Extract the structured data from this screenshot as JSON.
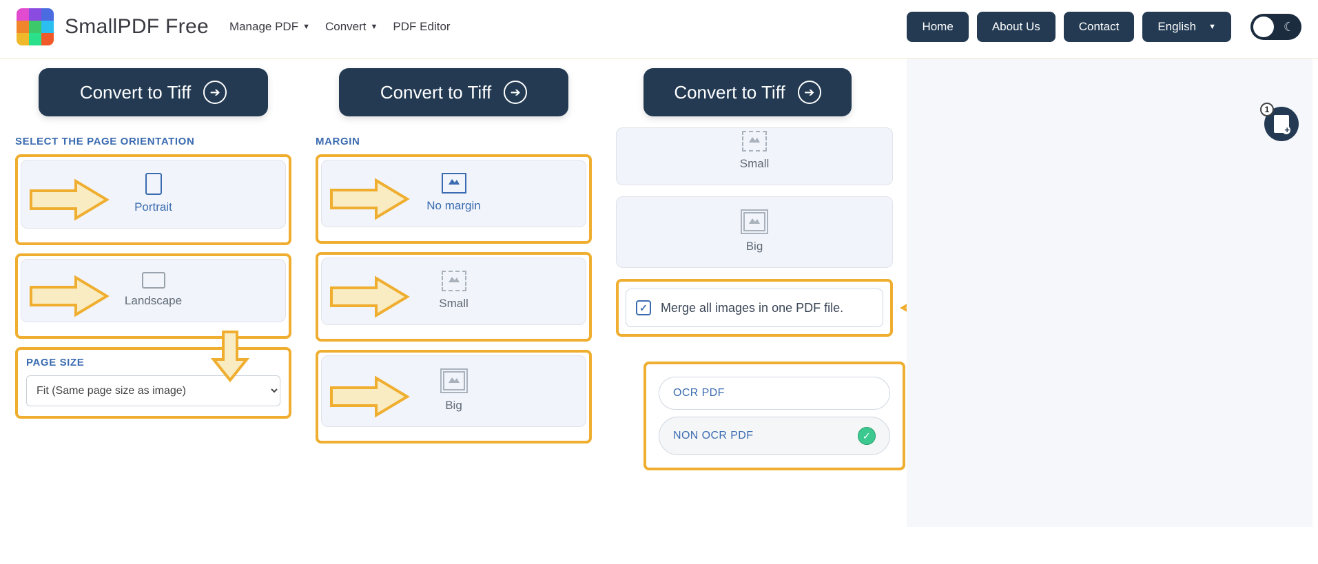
{
  "header": {
    "brand": "SmallPDF Free",
    "menu": [
      {
        "label": "Manage PDF",
        "has_chevron": true
      },
      {
        "label": "Convert",
        "has_chevron": true
      },
      {
        "label": "PDF Editor",
        "has_chevron": false
      }
    ],
    "nav": {
      "home": "Home",
      "about": "About Us",
      "contact": "Contact",
      "language": "English"
    }
  },
  "columns": {
    "c1": {
      "button": "Convert to Tiff",
      "orientation_heading": "SELECT THE PAGE ORIENTATION",
      "portrait": "Portrait",
      "landscape": "Landscape",
      "page_size_heading": "PAGE SIZE",
      "page_size_value": "Fit (Same page size as image)"
    },
    "c2": {
      "button": "Convert to Tiff",
      "margin_heading": "MARGIN",
      "no_margin": "No margin",
      "small": "Small",
      "big": "Big"
    },
    "c3": {
      "button": "Convert to Tiff",
      "small": "Small",
      "big": "Big",
      "merge_label": "Merge all images in one PDF file.",
      "ocr": "OCR PDF",
      "non_ocr": "NON OCR PDF"
    }
  },
  "fab": {
    "badge": "1"
  }
}
